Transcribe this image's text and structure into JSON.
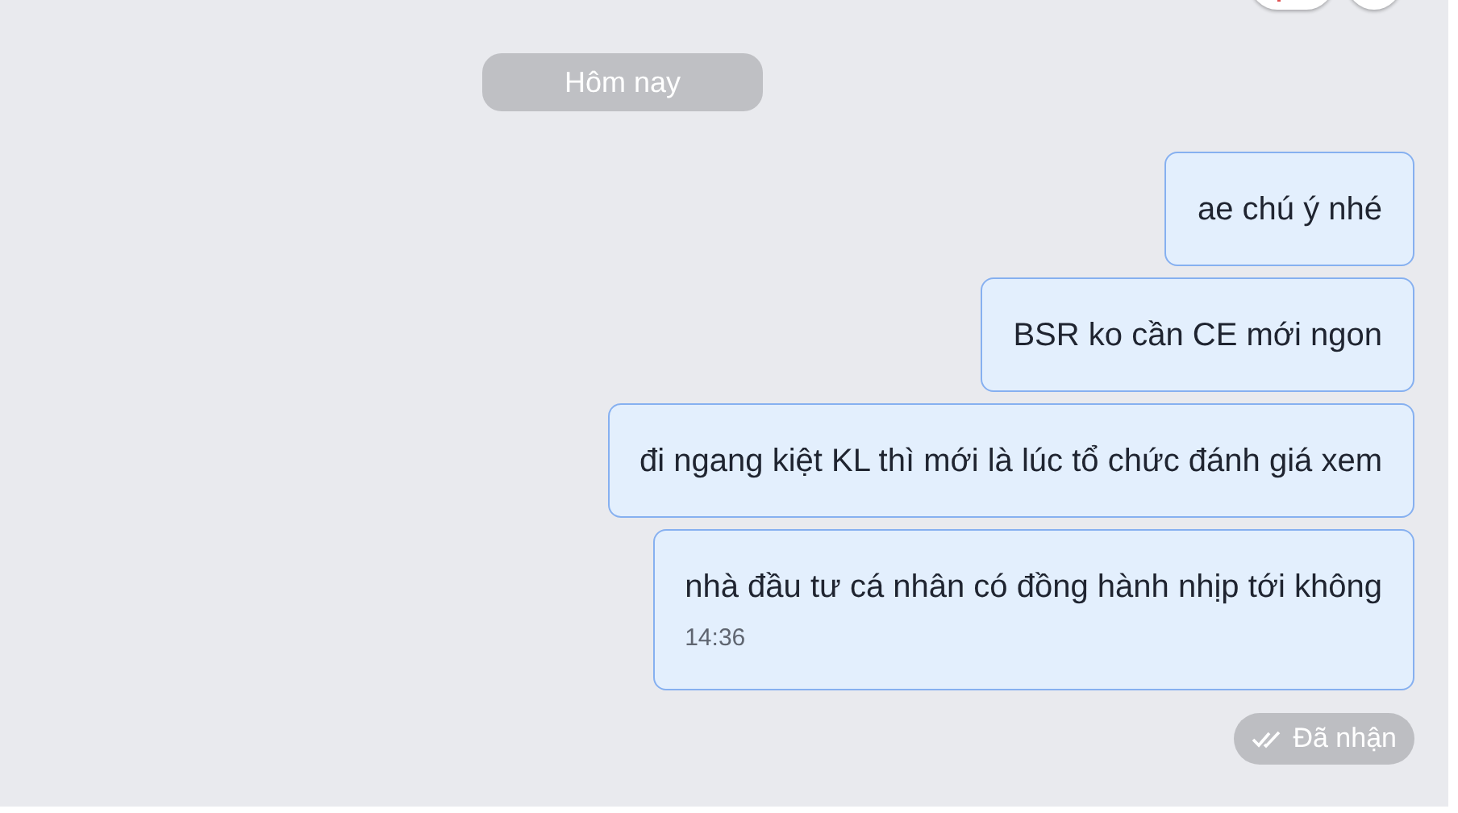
{
  "date_separator": "Hôm nay",
  "messages": [
    {
      "text": "ae chú ý nhé"
    },
    {
      "text": "BSR ko cần CE mới ngon"
    },
    {
      "text": "đi ngang kiệt KL thì mới là lúc tổ chức đánh giá xem"
    },
    {
      "text": "nhà đầu tư cá nhân có đồng hành nhịp tới không",
      "time": "14:36"
    }
  ],
  "status": {
    "label": "Đã nhận"
  }
}
